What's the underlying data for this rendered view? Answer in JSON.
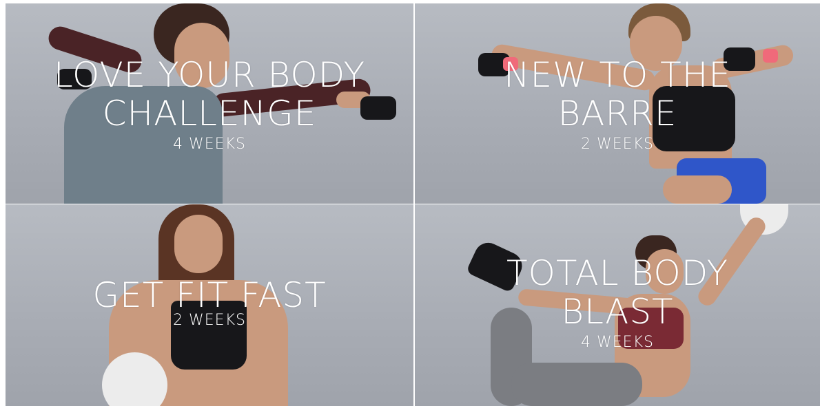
{
  "programs": [
    {
      "title_line1": "LOVE YOUR BODY",
      "title_line2": "CHALLENGE",
      "duration": "4 WEEKS"
    },
    {
      "title_line1": "NEW TO THE",
      "title_line2": "BARRE",
      "duration": "2 WEEKS"
    },
    {
      "title_line1": "GET FIT FAST",
      "title_line2": "",
      "duration": "2 WEEKS"
    },
    {
      "title_line1": "TOTAL BODY",
      "title_line2": "BLAST",
      "duration": "4 WEEKS"
    }
  ]
}
